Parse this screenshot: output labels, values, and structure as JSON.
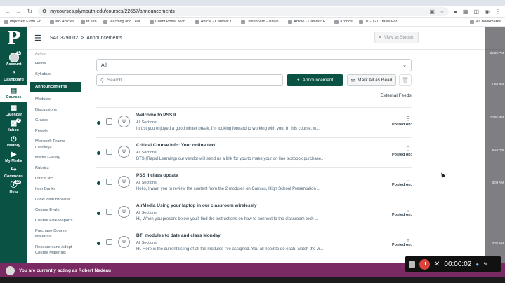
{
  "browser": {
    "url": "mycourses.plymouth.edu/courses/22657/announcements",
    "bookmarks": [
      "Imported From Fir...",
      "KB Articles",
      "td.ssh",
      "Teaching and Lear...",
      "Client Portal Tech...",
      "Article - Canvas: I...",
      "Dashboard - Unive...",
      "Article - Canvas: F...",
      "Kronos",
      "07 - 121 Travel For..."
    ],
    "all_bookmarks": "All Bookmarks"
  },
  "global_nav": {
    "logo": "P",
    "items": [
      {
        "label": "Account",
        "icon": "avatar-icon",
        "badge": "1"
      },
      {
        "label": "Dashboard",
        "icon": "dashboard-icon",
        "badge": ""
      },
      {
        "label": "Courses",
        "icon": "book-icon",
        "badge": ""
      },
      {
        "label": "Calendar",
        "icon": "calendar-icon",
        "badge": ""
      },
      {
        "label": "Inbox",
        "icon": "inbox-icon",
        "badge": "7"
      },
      {
        "label": "History",
        "icon": "clock-icon",
        "badge": ""
      },
      {
        "label": "My Media",
        "icon": "media-icon",
        "badge": ""
      },
      {
        "label": "Commons",
        "icon": "commons-icon",
        "badge": ""
      },
      {
        "label": "Help",
        "icon": "help-icon",
        "badge": "10"
      }
    ],
    "active": "Courses"
  },
  "header": {
    "course": "SAL 3290.02",
    "separator": ">",
    "page": "Announcements",
    "view_as_student": "View as Student"
  },
  "course_nav": {
    "term": "Active",
    "items": [
      "Home",
      "Syllabus",
      "Announcements",
      "Modules",
      "Discussions",
      "Grades",
      "People",
      "Microsoft Teams meetings",
      "Media Gallery",
      "Rubrics",
      "Office 365",
      "Item Banks",
      "LockDown Browser",
      "Course Evals",
      "Course Eval Reports",
      "Purchase Course Materials",
      "Research and Adopt Course Materials"
    ],
    "active_index": 2
  },
  "toolbar": {
    "filter_value": "All",
    "search_placeholder": "Search...",
    "add_label": "Announcement",
    "mark_all_label": "Mark All as Read",
    "external_feeds": "External Feeds"
  },
  "announcements": [
    {
      "title": "Welcome to PSS II",
      "sections": "All Sections",
      "preview": "I trust you enjoyed a good winter break. I'm looking forward to working with you. In this course, w...",
      "posted": "Posted on:",
      "avatar": "U"
    },
    {
      "title": "Critical Course info: Your online text",
      "sections": "All Sections",
      "preview": "BTS (Rapid Learning) our vendor will send us a link for you to make your on line textbook purchase...",
      "posted": "Posted on:",
      "avatar": "U"
    },
    {
      "title": "PSS II class update",
      "sections": "All Sections",
      "preview": "Hello, I want you to review the content from the 2 modules on Canvas, High School Presentation ...",
      "posted": "Posted on:",
      "avatar": "U"
    },
    {
      "title": "AirMedia Using your laptop in our classroom wirelessly",
      "sections": "All Sections",
      "preview": "Hi, When you present below you'll find the instructions on how to connect to the classroom tech ...",
      "posted": "Posted on:",
      "avatar": "U"
    },
    {
      "title": "BTI modules to date and class Monday",
      "sections": "All Sections",
      "preview": "Hi. Here is the current listing of all the modules I've assigned. You all need to do each, watch the vi...",
      "posted": "Posted on:",
      "avatar": "U"
    }
  ],
  "acting_banner": "You are currently acting as Robert Nadeau",
  "side_times": [
    "12:25 PM",
    "1:50 PM",
    "10:55 PM",
    "9.28 AM",
    "3.09 AM",
    "3.32 AM"
  ],
  "recorder": {
    "timer": "00:00:02"
  }
}
